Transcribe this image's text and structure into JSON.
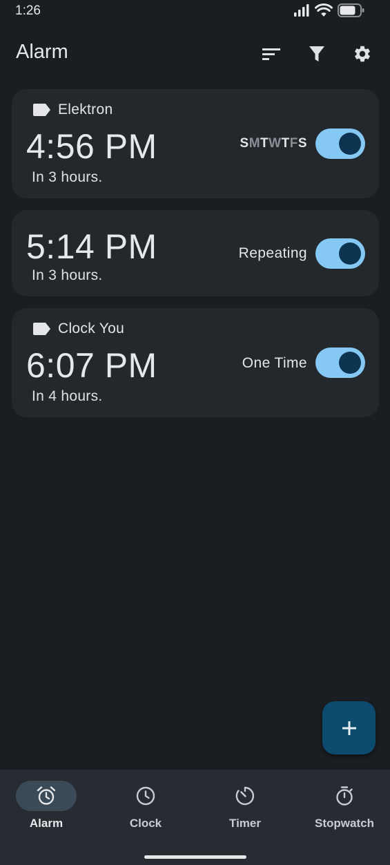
{
  "status_bar": {
    "time": "1:26"
  },
  "app_bar": {
    "title": "Alarm"
  },
  "alarms": [
    {
      "label": "Elektron",
      "time": "4:56 PM",
      "subtitle": "In 3 hours.",
      "days": [
        {
          "letter": "S",
          "on": true
        },
        {
          "letter": "M",
          "on": false
        },
        {
          "letter": "T",
          "on": true
        },
        {
          "letter": "W",
          "on": false
        },
        {
          "letter": "T",
          "on": true
        },
        {
          "letter": "F",
          "on": false
        },
        {
          "letter": "S",
          "on": true
        }
      ],
      "enabled": true
    },
    {
      "label": "",
      "time": "5:14 PM",
      "subtitle": "In 3 hours.",
      "repeat": "Repeating",
      "enabled": true
    },
    {
      "label": "Clock You",
      "time": "6:07 PM",
      "subtitle": "In 4 hours.",
      "repeat": "One Time",
      "enabled": true
    }
  ],
  "nav": {
    "items": [
      {
        "label": "Alarm",
        "icon": "alarm-icon",
        "active": true
      },
      {
        "label": "Clock",
        "icon": "clock-icon",
        "active": false
      },
      {
        "label": "Timer",
        "icon": "timer-icon",
        "active": false
      },
      {
        "label": "Stopwatch",
        "icon": "stopwatch-icon",
        "active": false
      }
    ]
  },
  "colors": {
    "background": "#1a1d21",
    "card": "#23282d",
    "toggle_track": "#86c8f4",
    "toggle_knob": "#0d3552",
    "fab": "#0c4a6e",
    "nav_bg": "#262c32",
    "nav_active": "#3a4a57"
  }
}
